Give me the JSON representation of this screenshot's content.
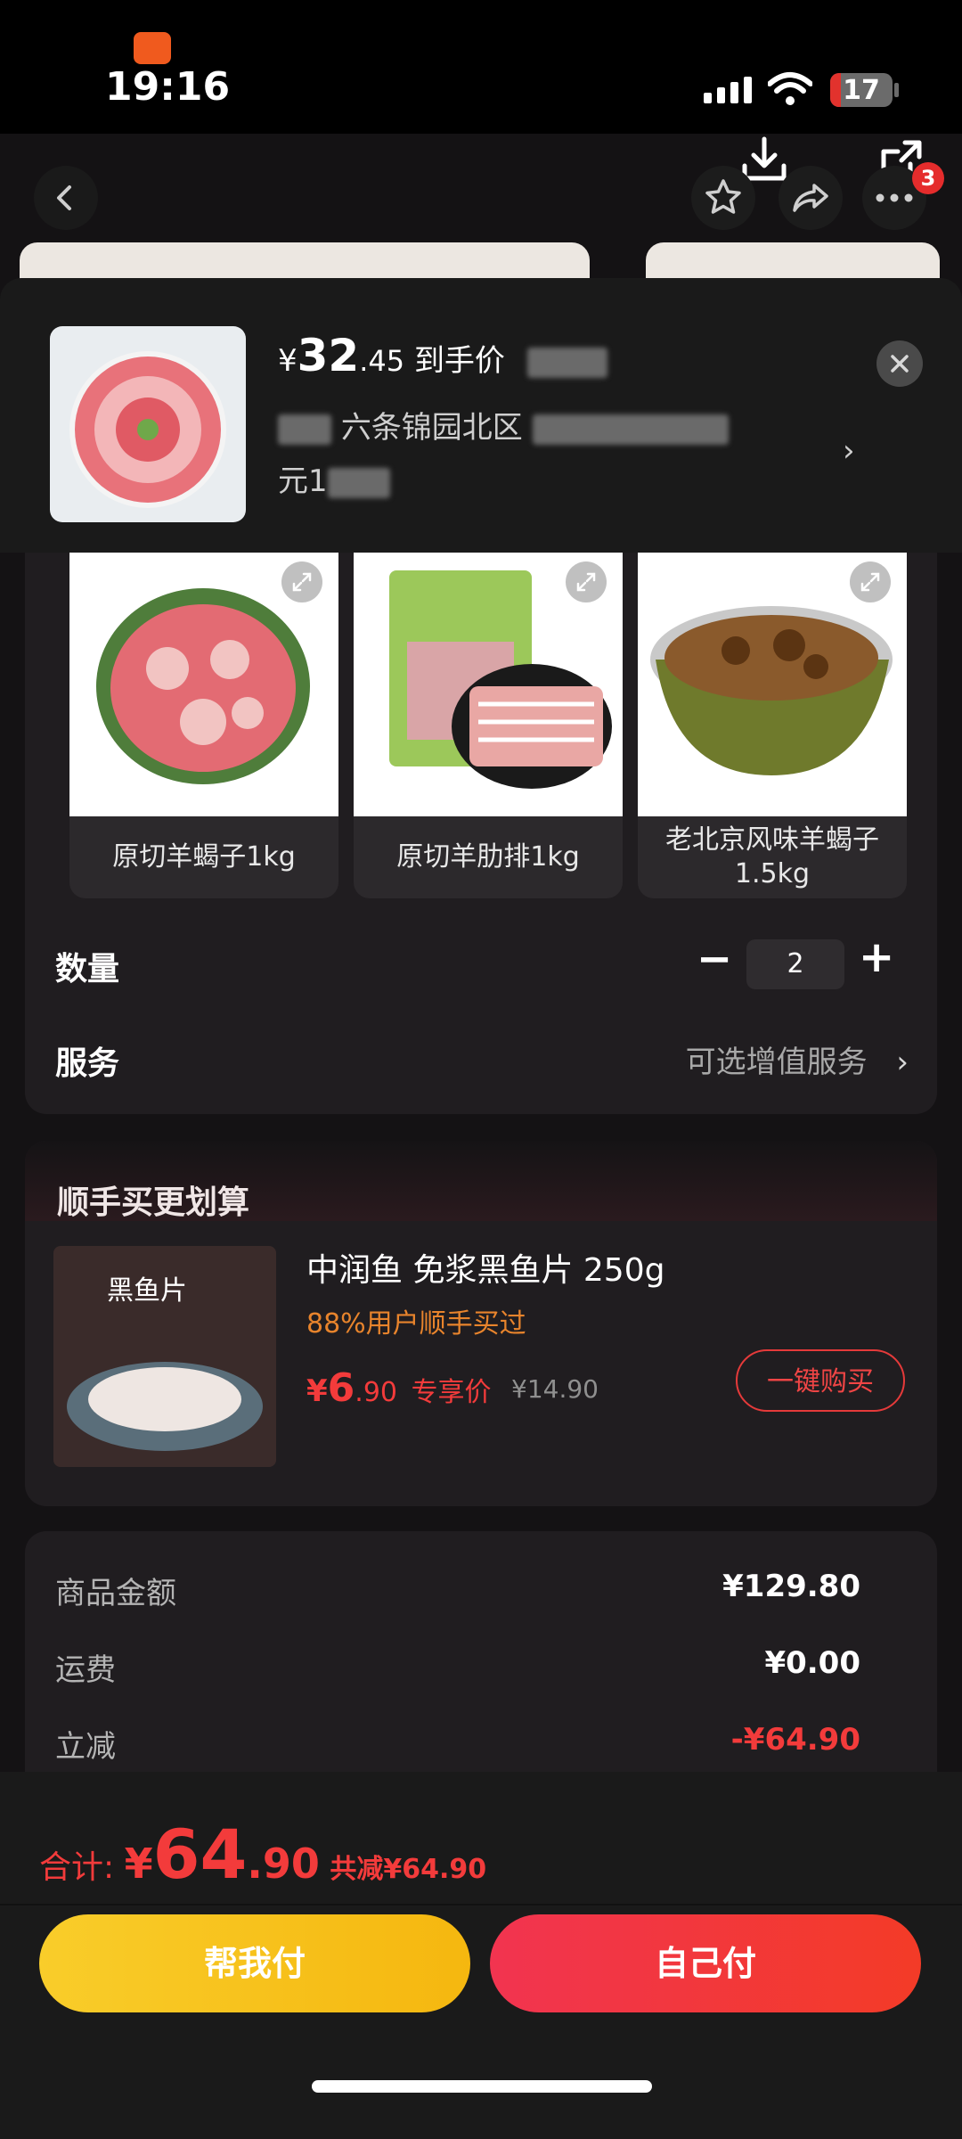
{
  "status": {
    "time": "19:16",
    "battery": "17"
  },
  "popup": {
    "price_symbol": "¥",
    "price_int": "32",
    "price_dec": ".45",
    "price_label": "到手价",
    "address_visible": "六条锦园北区",
    "address_line2": "元1",
    "colors": {
      "accent": "#f33b3b"
    }
  },
  "products": [
    {
      "label": "原切羊蝎子1kg"
    },
    {
      "label": "原切羊肋排1kg"
    },
    {
      "label": "老北京风味羊蝎子1.5kg"
    }
  ],
  "quantity": {
    "label": "数量",
    "value": "2",
    "minus": "−",
    "plus": "+"
  },
  "service": {
    "label": "服务",
    "value": "可选增值服务"
  },
  "recommend": {
    "title": "顺手买更划算",
    "name": "中润鱼 免浆黑鱼片 250g",
    "stat": "88%用户顺手买过",
    "price_symbol": "¥",
    "price_int": "6",
    "price_dec": ".90",
    "price_tag": "专享价",
    "orig_price": "¥14.90",
    "buy_label": "一键购买"
  },
  "summary": [
    {
      "label": "商品金额",
      "value": "¥129.80"
    },
    {
      "label": "运费",
      "value": "¥0.00"
    },
    {
      "label": "立减",
      "value": "-¥64.90"
    }
  ],
  "footer": {
    "total_label": "合计:",
    "total_symbol": "¥",
    "total_int": "64",
    "total_dec": ".90",
    "saved": "共减¥64.90",
    "help_pay": "帮我付",
    "self_pay": "自己付"
  },
  "icons": [
    "back-icon",
    "star-icon",
    "share-icon",
    "more-icon",
    "download-icon",
    "external-share-icon",
    "close-icon",
    "chevron-right-icon",
    "zoom-icon"
  ]
}
